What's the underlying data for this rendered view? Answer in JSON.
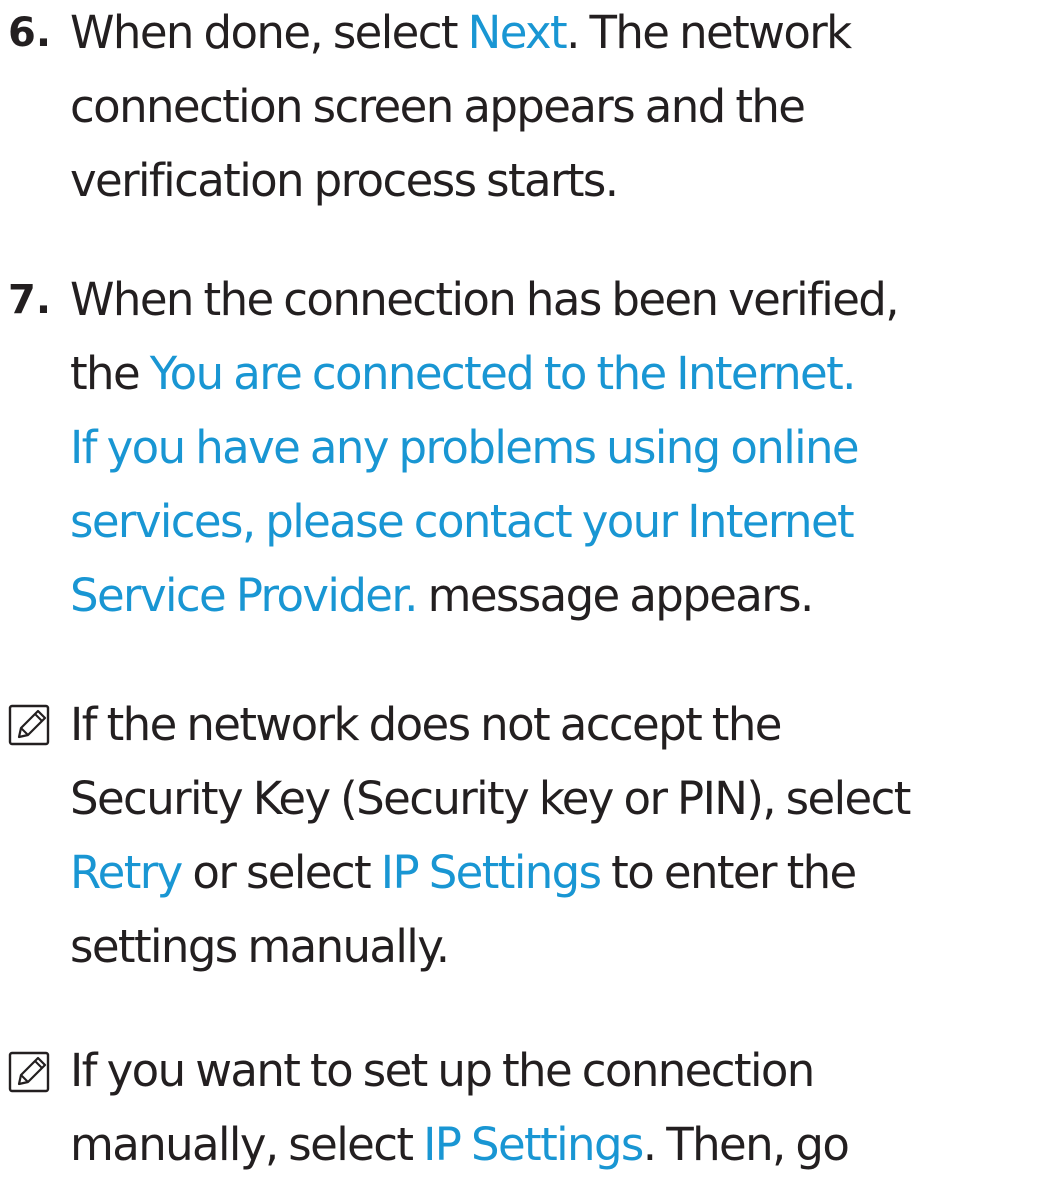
{
  "colors": {
    "text": "#231f20",
    "highlight": "#1996d3"
  },
  "step6": {
    "number": "6.",
    "l1_a": "When done, select ",
    "l1_next": "Next",
    "l1_b": ". The network",
    "l2": "connection screen appears and the",
    "l3": "verification process starts."
  },
  "step7": {
    "number": "7.",
    "l1": " When the connection has been verified,",
    "l2_a": "the ",
    "l2_msg": "You are connected to the Internet.",
    "l3_msg": "If you have any problems using online",
    "l4_msg": "services, please contact your Internet",
    "l5_msg": "Service Provider.",
    "l5_b": " message appears."
  },
  "note1": {
    "icon": "note-icon",
    "l1": "If the network does not accept the",
    "l2": "Security Key (Security key or PIN), select",
    "l3_retry": "Retry",
    "l3_a": " or select ",
    "l3_ip": "IP Settings",
    "l3_b": " to enter the",
    "l4": "settings manually."
  },
  "note2": {
    "icon": "note-icon",
    "l1": "If you want to set up the connection",
    "l2_a": "manually, select ",
    "l2_ip": "IP Settings",
    "l2_b": ". Then, go"
  }
}
